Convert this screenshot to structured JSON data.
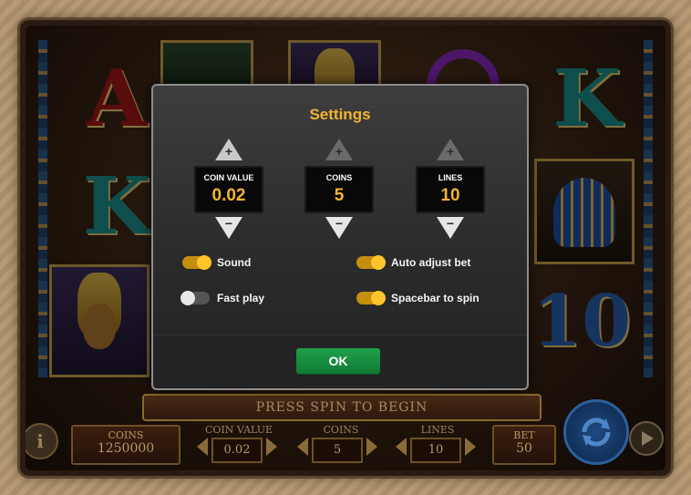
{
  "dialog": {
    "title": "Settings",
    "steppers": [
      {
        "label": "COIN VALUE",
        "value": "0.02",
        "up_enabled": true
      },
      {
        "label": "COINS",
        "value": "5",
        "up_enabled": false
      },
      {
        "label": "LINES",
        "value": "10",
        "up_enabled": false
      }
    ],
    "up_symbol": "+",
    "down_symbol": "−",
    "toggles": [
      {
        "label": "Sound",
        "on": true
      },
      {
        "label": "Fast play",
        "on": false
      },
      {
        "label": "Auto adjust bet",
        "on": true
      },
      {
        "label": "Spacebar to spin",
        "on": true
      }
    ],
    "ok_label": "OK"
  },
  "game": {
    "banner": "PRESS SPIN TO BEGIN",
    "reel_symbols": [
      "A",
      "K",
      "K",
      "10"
    ],
    "hud": {
      "coins_label": "COINS",
      "coins_value": "1250000",
      "coin_value_label": "COIN VALUE",
      "coin_value": "0.02",
      "coins_bet_label": "COINS",
      "coins_bet": "5",
      "lines_label": "LINES",
      "lines": "10",
      "bet_label": "BET",
      "bet": "50",
      "info_icon": "i"
    }
  },
  "colors": {
    "accent": "#f2b430",
    "ok_green": "#1fa14a",
    "toggle_on": "#ffc52a",
    "toggle_off": "#e8e8e8"
  }
}
